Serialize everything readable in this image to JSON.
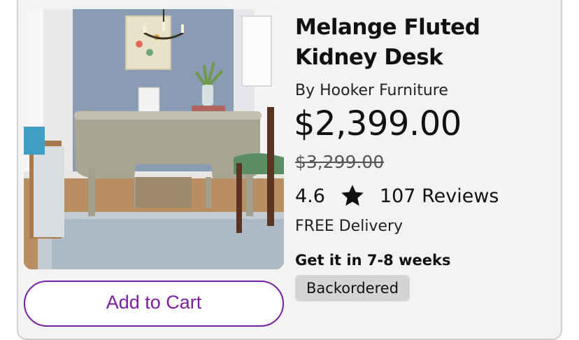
{
  "product": {
    "title": "Melange Fluted Kidney Desk",
    "brand": "By Hooker Furniture",
    "price": "$2,399.00",
    "original_price": "$3,299.00",
    "rating": "4.6",
    "reviews": "107 Reviews",
    "delivery": "FREE Delivery",
    "eta": "Get it in 7-8 weeks",
    "status_badge": "Backordered",
    "image_alt": "Melange Fluted Kidney Desk in a home office"
  },
  "actions": {
    "add_to_cart_label": "Add to Cart"
  },
  "icons": {
    "rating": "star-icon"
  },
  "colors": {
    "accent": "#7b1fa2",
    "card_background": "#f3f3f3",
    "badge_background": "#d4d4d7"
  }
}
